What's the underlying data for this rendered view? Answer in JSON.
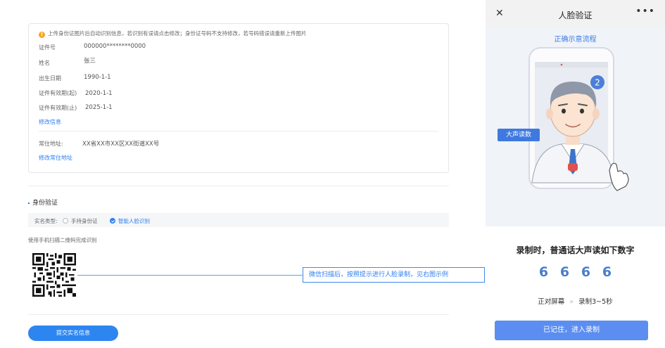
{
  "form": {
    "notice": "上传身份证图片后自动识别信息，若识别有误请点击修改；身份证号码不支持修改，若号码错误请重新上传图片",
    "fields": [
      {
        "label": "证件号",
        "value": "000000********0000"
      },
      {
        "label": "姓名",
        "value": "张三"
      },
      {
        "label": "出生日期",
        "value": "1990-1-1"
      },
      {
        "label": "证件有效期(起)",
        "value": "2020-1-1"
      },
      {
        "label": "证件有效期(止)",
        "value": "2025-1-1"
      }
    ],
    "edit_info_link": "修改信息",
    "address_label": "常住地址:",
    "address_value": "XX省XX市XX区XX街道XX号",
    "edit_address_link": "修改常住地址"
  },
  "verify": {
    "section_title": "身份验证",
    "type_label": "实名类型:",
    "options": [
      "手持身份证",
      "智能人脸识别"
    ],
    "selected_index": 1,
    "scan_hint": "使用手机扫描二维码完成识别",
    "callout": "微信扫描后，按照提示进行人脸录制，见右图示例",
    "submit_label": "提交实名信息"
  },
  "phone": {
    "title": "人脸验证",
    "close_icon": "close-icon",
    "more_icon": "more-icon",
    "demo_link": "正确示意流程",
    "step_badge": "2",
    "read_badge": "大声读数",
    "record_title": "录制时，普通话大声读如下数字",
    "digits": [
      "6",
      "6",
      "6",
      "6"
    ],
    "step1": "正对屏幕",
    "step2": "录制3~5秒",
    "record_button": "已记住，进入录制"
  },
  "colors": {
    "accent": "#2d86f0",
    "phone_button": "#5b8ef0",
    "digits": "#4a7fc8"
  }
}
